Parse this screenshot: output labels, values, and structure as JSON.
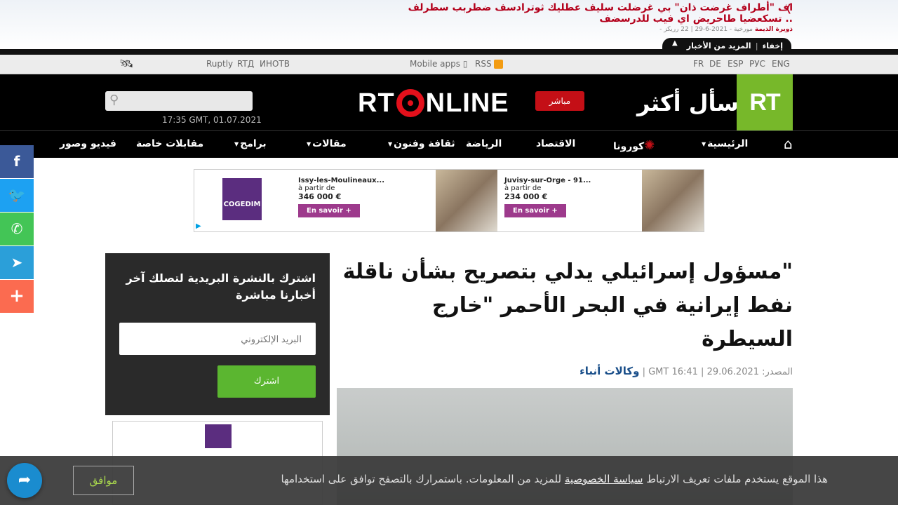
{
  "ticker": {
    "headline": "اف \"أطراف غرضت ذان\" بي غرضلت سليف عطليك ثوترادسف ضطربب سطرلف .. تسكعضيا طاحريض اي فيب للدرسضف",
    "source": "ذويرة الذيمة",
    "meta": "مورخية - 2021-6-29 | 22 رريكز -",
    "more_label": "المزيد من الأخبار",
    "hide_label": "إخفاء"
  },
  "topbar": {
    "links_left": [
      "Ruptly",
      "RTД",
      "ИНОТВ"
    ],
    "mobile_apps": "Mobile apps",
    "rss": "RSS",
    "languages": [
      "FR",
      "DE",
      "ESP",
      "РУС",
      "ENG"
    ]
  },
  "header": {
    "search_placeholder": "",
    "datetime": "17:35 GMT, 01.07.2021",
    "logo_left": "RT",
    "logo_right": "NLINE",
    "live_label": "مباشر",
    "slogan": "اسأل أكثر",
    "brand": "RT"
  },
  "nav": {
    "items": [
      {
        "label": "الرئيسية",
        "caret": true
      },
      {
        "label": "كورونا",
        "caret": false
      },
      {
        "label": "الاقتصاد",
        "caret": false
      },
      {
        "label": "الرياضة",
        "caret": false
      },
      {
        "label": "ثقافة وفنون",
        "caret": true
      },
      {
        "label": "مقالات",
        "caret": true
      },
      {
        "label": "برامج",
        "caret": true
      },
      {
        "label": "مقابلات خاصة",
        "caret": false
      },
      {
        "label": "فيديو وصور",
        "caret": false
      }
    ]
  },
  "ad": {
    "brand": "COGEDIM",
    "tagline": "VOUS VERREZ LA DIFFÉRENCE",
    "listings": [
      {
        "title": "Issy-les-Moulineaux...",
        "from": "à partir de",
        "price": "346 000 €",
        "cta": "En savoir +"
      },
      {
        "title": "Juvisy-sur-Orge - 91...",
        "from": "à partir de",
        "price": "234 000 €",
        "cta": "En savoir +"
      }
    ]
  },
  "newsletter": {
    "title": "اشترك بالنشرة البريدية لتصلك آخر أخبارنا مباشرة",
    "email_placeholder": "البريد الإلكتروني",
    "subscribe_label": "اشترك"
  },
  "article": {
    "headline": "\"مسؤول إسرائيلي يدلي بتصريح بشأن ناقلة نفط إيرانية في البحر الأحمر \"خارج السيطرة",
    "source_label": "المصدر:",
    "source": "وكالات أنباء",
    "date": "29.06.2021 | 16:41 GMT |"
  },
  "cookie": {
    "text_before": "هذا الموقع يستخدم ملفات تعريف الارتباط",
    "link": "سياسة الخصوصية",
    "text_after": "للمزيد من المعلومات. باستمرارك بالتصفح توافق على استخدامها",
    "ok_label": "موافق"
  },
  "share": {
    "colors": {
      "facebook": "#3b5998",
      "twitter": "#1da1f2",
      "whatsapp": "#43c556",
      "telegram": "#2b9fd9",
      "more": "#fb6b50"
    }
  }
}
